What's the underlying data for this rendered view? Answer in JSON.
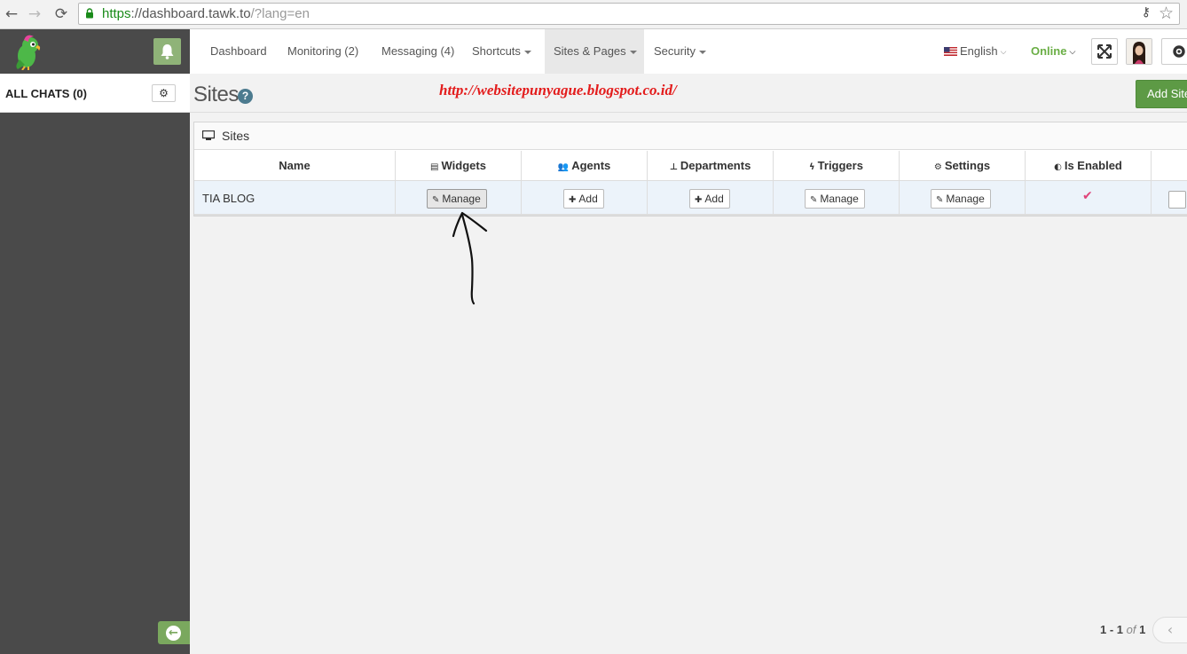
{
  "browser": {
    "url_scheme": "https",
    "url_host": "://dashboard.tawk.to",
    "url_path": "/?lang=en",
    "back_icon": "←",
    "forward_icon": "→",
    "reload_icon": "⟳",
    "key_icon": "⚷",
    "star_icon": "☆"
  },
  "sidebar": {
    "all_chats_label": "ALL CHATS (0)",
    "gear_icon": "⚙",
    "collapse_icon": "←"
  },
  "topnav": {
    "items": [
      {
        "label": "Dashboard"
      },
      {
        "label": "Monitoring (2)"
      },
      {
        "label": "Messaging (4)"
      },
      {
        "label": "Shortcuts"
      },
      {
        "label": "Sites & Pages"
      },
      {
        "label": "Security"
      }
    ],
    "language": "English",
    "status": "Online"
  },
  "page": {
    "title": "Sites",
    "help": "?",
    "watermark": "http://websitepunyague.blogspot.co.id/",
    "add_site_label": "Add Site"
  },
  "panel": {
    "title": "Sites",
    "columns": [
      {
        "label": "Name",
        "icon": ""
      },
      {
        "label": "Widgets",
        "icon": "▤"
      },
      {
        "label": "Agents",
        "icon": "👥"
      },
      {
        "label": "Departments",
        "icon": "⊥"
      },
      {
        "label": "Triggers",
        "icon": "ϟ"
      },
      {
        "label": "Settings",
        "icon": "⚙"
      },
      {
        "label": "Is Enabled",
        "icon": "◐"
      }
    ],
    "rows": [
      {
        "name": "TIA BLOG",
        "widgets_btn": "Manage",
        "agents_btn": "Add",
        "departments_btn": "Add",
        "triggers_btn": "Manage",
        "settings_btn": "Manage",
        "enabled_mark": "✔"
      }
    ]
  },
  "pagination": {
    "range": "1 - 1",
    "of_label": "of",
    "total": "1",
    "prev_icon": "‹"
  },
  "colors": {
    "sidebar_bg": "#4a4a4a",
    "accent_green": "#5d9a45",
    "online_green": "#6aae45",
    "watermark_red": "#e31c1c",
    "enabled_pink": "#e0447a"
  }
}
